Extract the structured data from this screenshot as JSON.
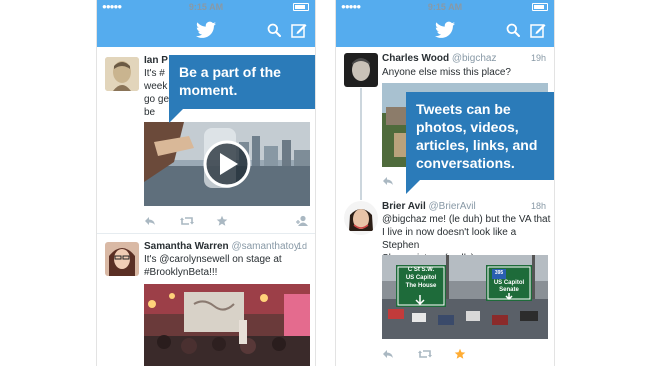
{
  "left_phone": {
    "status": {
      "signal": "●●●●●",
      "time": "9:15 AM"
    },
    "callout": {
      "line1": "Be a part of the",
      "line2": "moment."
    },
    "tweet1": {
      "name": "Ian P",
      "text_lines": [
        "It's #",
        "week",
        "go ge",
        "be"
      ]
    },
    "tweet2": {
      "name": "Samantha Warren",
      "handle": "@samanthatoy",
      "time": "1d",
      "text_lines": [
        "It's @carolynsewell on stage at",
        "#BrooklynBeta!!!"
      ]
    }
  },
  "right_phone": {
    "status": {
      "signal": "●●●●●",
      "time": "9:15 AM"
    },
    "callout": {
      "line1": "Tweets can be",
      "line2": "photos, videos,",
      "line3": "articles, links, and",
      "line4": "conversations."
    },
    "tweet1": {
      "name": "Charles Wood",
      "handle": "@bigchaz",
      "time": "19h",
      "text_lines": [
        "Anyone else miss this place?"
      ]
    },
    "tweet2": {
      "name": "Brier Avil",
      "handle": "@BrierAvil",
      "time": "18h",
      "text_lines": [
        "@bigchaz me! (le duh) but the VA that",
        "I live in now doesn't look like a Stephen",
        "Shore picture (sadly)"
      ]
    },
    "signs": {
      "left_line1": "C St S.W.",
      "left_line2": "US Capitol",
      "left_line3": "The House",
      "right_shield": "395",
      "right_line1": "US Capitol",
      "right_line2": "Senate"
    }
  },
  "colors": {
    "brand": "#55acee",
    "callout": "#2b7bb9",
    "favorite": "#ffac33"
  },
  "icons": [
    "bird-icon",
    "search-icon",
    "compose-icon",
    "reply-icon",
    "retweet-icon",
    "favorite-icon",
    "follow-icon",
    "play-icon"
  ]
}
